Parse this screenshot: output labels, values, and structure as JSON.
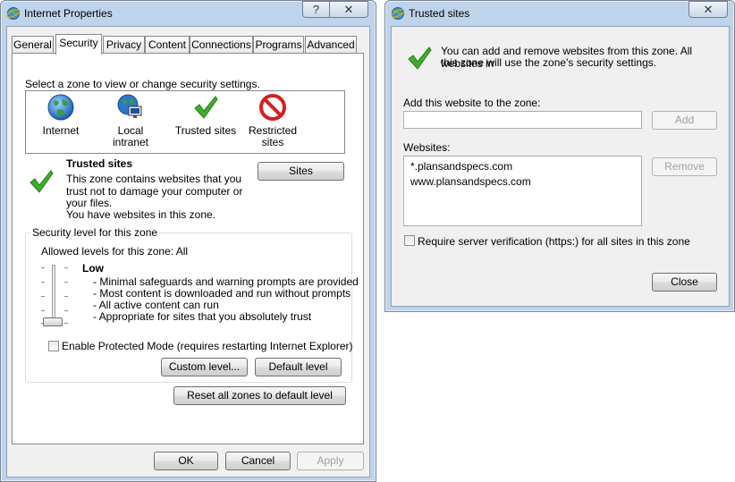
{
  "props_window": {
    "title": "Internet Properties",
    "help_glyph": "?",
    "close_glyph": "✕",
    "tabs": [
      "General",
      "Security",
      "Privacy",
      "Content",
      "Connections",
      "Programs",
      "Advanced"
    ],
    "active_tab": "Security",
    "select_zone_prompt": "Select a zone to view or change security settings.",
    "zones": [
      {
        "label": "Internet",
        "icon": "globe-icon"
      },
      {
        "label": "Local intranet",
        "icon": "intranet-icon"
      },
      {
        "label": "Trusted sites",
        "icon": "checkmark-icon",
        "selected": true
      },
      {
        "label": "Restricted sites",
        "icon": "restricted-icon"
      }
    ],
    "zone_info": {
      "title": "Trusted sites",
      "desc_lines": [
        "This zone contains websites that you",
        "trust not to damage your computer or",
        "your files.",
        "You have websites in this zone."
      ],
      "sites_button": "Sites"
    },
    "security_level": {
      "group_title": "Security level for this zone",
      "allowed": "Allowed levels for this zone: All",
      "level_name": "Low",
      "level_value": 0,
      "bullets": [
        "- Minimal safeguards and warning prompts are provided",
        "- Most content is downloaded and run without prompts",
        "- All active content can run",
        "- Appropriate for sites that you absolutely trust"
      ],
      "protected_mode_label": "Enable Protected Mode (requires restarting Internet Explorer)",
      "protected_mode_checked": false,
      "custom_level_button": "Custom level...",
      "default_level_button": "Default level"
    },
    "reset_button": "Reset all zones to default level",
    "ok_button": "OK",
    "cancel_button": "Cancel",
    "apply_button": "Apply"
  },
  "trusted_window": {
    "title": "Trusted sites",
    "close_glyph": "✕",
    "info_text_lines": [
      "You can add and remove websites from this zone. All websites in",
      "this zone will use the zone's security settings."
    ],
    "add_label": "Add this website to the zone:",
    "add_input_value": "",
    "add_button": "Add",
    "websites_label": "Websites:",
    "websites": [
      "*.plansandspecs.com",
      "www.plansandspecs.com"
    ],
    "remove_button": "Remove",
    "https_label": "Require server verification (https:) for all sites in this zone",
    "https_checked": false,
    "close_button": "Close"
  },
  "colors": {
    "check_green": "#3fae2a",
    "title_frame": "#bfd3ea",
    "restricted_red": "#d42020"
  }
}
